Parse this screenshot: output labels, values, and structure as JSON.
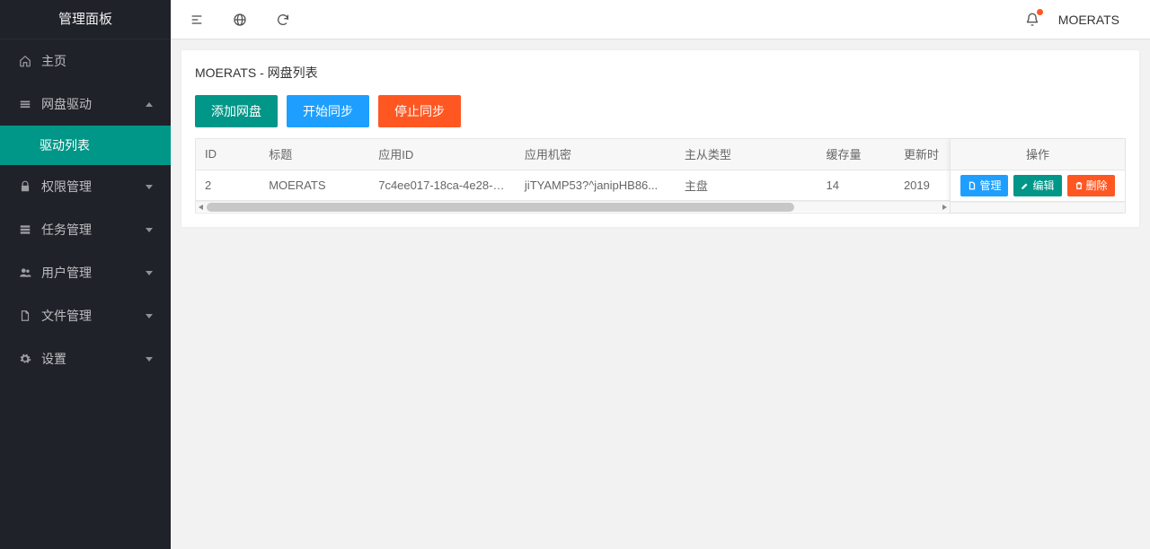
{
  "sidebar": {
    "title": "管理面板",
    "items": [
      {
        "label": "主页"
      },
      {
        "label": "网盘驱动"
      },
      {
        "label": "驱动列表"
      },
      {
        "label": "权限管理"
      },
      {
        "label": "任务管理"
      },
      {
        "label": "用户管理"
      },
      {
        "label": "文件管理"
      },
      {
        "label": "设置"
      }
    ]
  },
  "topbar": {
    "username": "MOERATS"
  },
  "page": {
    "title": "MOERATS - 网盘列表",
    "add_btn": "添加网盘",
    "sync_start_btn": "开始同步",
    "sync_stop_btn": "停止同步"
  },
  "table": {
    "headers": {
      "id": "ID",
      "title": "标题",
      "app_id": "应用ID",
      "app_secret": "应用机密",
      "type": "主从类型",
      "cache": "缓存量",
      "update": "更新时",
      "action": "操作"
    },
    "rows": [
      {
        "id": "2",
        "title": "MOERATS",
        "app_id": "7c4ee017-18ca-4e28-8...",
        "app_secret": "jiTYAMP53?^janipHB86...",
        "type": "主盘",
        "cache": "14",
        "update": "2019"
      }
    ],
    "actions": {
      "manage": "管理",
      "edit": "编辑",
      "delete": "删除"
    }
  }
}
